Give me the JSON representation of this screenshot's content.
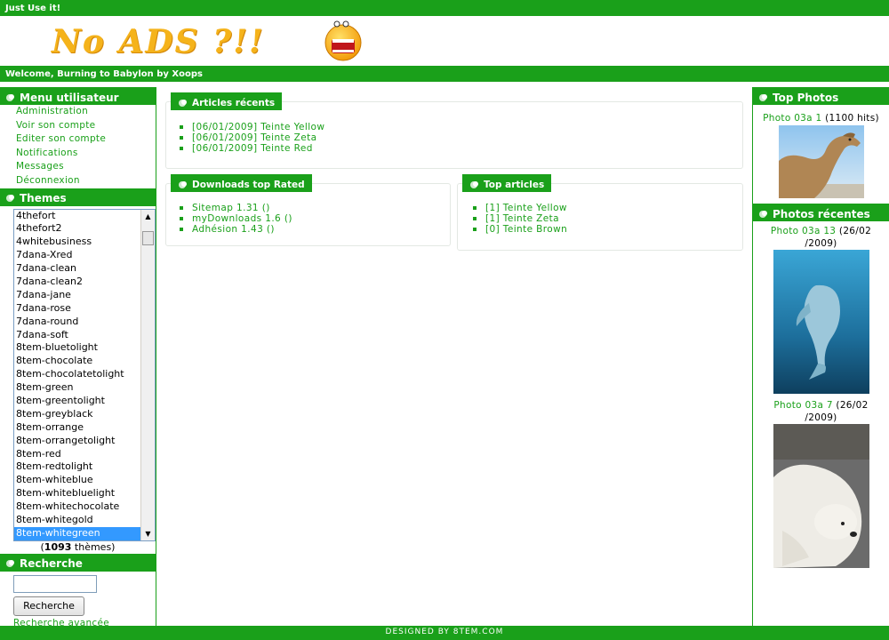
{
  "site": {
    "top_text": "Just Use it!",
    "banner_text": "No ADS ?!!",
    "welcome_text": "Welcome, Burning to Babylon by Xoops",
    "footer_text": "DESIGNED BY 8TEM.COM"
  },
  "colors": {
    "accent": "#1aa01a",
    "selected": "#3399ff",
    "banner_yellow": "#f5b31b"
  },
  "user_menu": {
    "title": "Menu utilisateur",
    "items": [
      "Administration",
      "Voir son compte",
      "Editer son compte",
      "Notifications",
      "Messages",
      "Déconnexion"
    ]
  },
  "themes": {
    "title": "Themes",
    "options": [
      "4thefort",
      "4thefort2",
      "4whitebusiness",
      "7dana-Xred",
      "7dana-clean",
      "7dana-clean2",
      "7dana-jane",
      "7dana-rose",
      "7dana-round",
      "7dana-soft",
      "8tem-bluetolight",
      "8tem-chocolate",
      "8tem-chocolatetolight",
      "8tem-green",
      "8tem-greentolight",
      "8tem-greyblack",
      "8tem-orrange",
      "8tem-orrangetolight",
      "8tem-red",
      "8tem-redtolight",
      "8tem-whiteblue",
      "8tem-whitebluelight",
      "8tem-whitechocolate",
      "8tem-whitegold",
      "8tem-whitegreen"
    ],
    "selected": "8tem-whitegreen",
    "count_prefix": "(",
    "count": "1093",
    "count_suffix": " thèmes)"
  },
  "search": {
    "title": "Recherche",
    "input_value": "",
    "button_label": "Recherche",
    "advanced_label": "Recherche avancée"
  },
  "articles_recents": {
    "title": "Articles récents",
    "items": [
      "[06/01/2009] Teinte Yellow",
      "[06/01/2009] Teinte Zeta",
      "[06/01/2009] Teinte Red"
    ]
  },
  "downloads_top": {
    "title": "Downloads top Rated",
    "items": [
      "Sitemap 1.31 ()",
      "myDownloads 1.6 ()",
      "Adhésion 1.43 ()"
    ]
  },
  "top_articles": {
    "title": "Top articles",
    "items": [
      "[1] Teinte Yellow",
      "[1] Teinte Zeta",
      "[0] Teinte Brown"
    ]
  },
  "top_photos": {
    "title": "Top Photos",
    "items": [
      {
        "name": "Photo 03a 1",
        "meta": " (1100 hits)",
        "icon": "camel-photo"
      }
    ]
  },
  "photos_recentes": {
    "title": "Photos récentes",
    "items": [
      {
        "name": "Photo 03a 13",
        "meta_1": " (26/02",
        "meta_2": "/2009)",
        "icon": "dolphin-photo"
      },
      {
        "name": "Photo 03a 7",
        "meta_1": " (26/02",
        "meta_2": "/2009)",
        "icon": "polar-bear-photo"
      }
    ]
  }
}
